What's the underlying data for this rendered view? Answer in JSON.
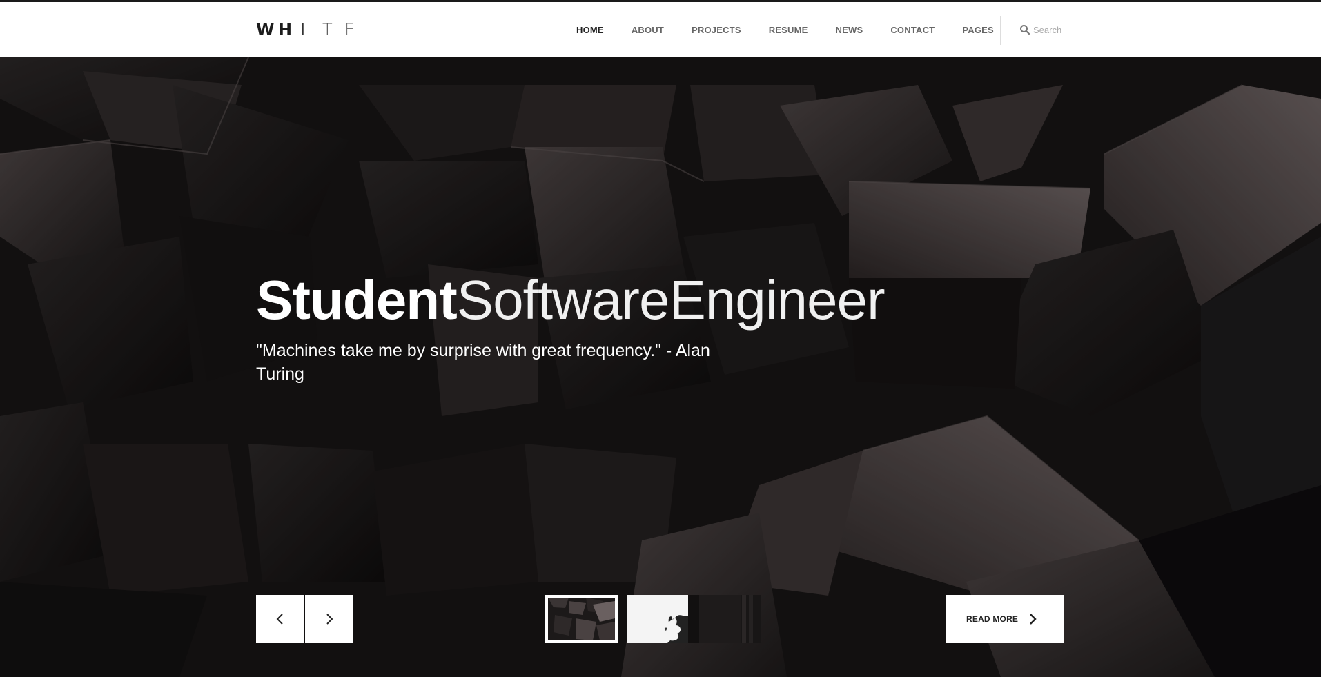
{
  "brand": {
    "logo_letters": [
      "W",
      "H",
      "I",
      "T",
      "E"
    ]
  },
  "nav": {
    "items": [
      {
        "label": "HOME",
        "active": true
      },
      {
        "label": "ABOUT",
        "active": false
      },
      {
        "label": "PROJECTS",
        "active": false
      },
      {
        "label": "RESUME",
        "active": false
      },
      {
        "label": "NEWS",
        "active": false
      },
      {
        "label": "CONTACT",
        "active": false
      },
      {
        "label": "PAGES",
        "active": false
      }
    ]
  },
  "search": {
    "placeholder": "Search",
    "icon": "search-icon"
  },
  "hero": {
    "title_bold": "Student",
    "title_light": "SoftwareEngineer",
    "quote": "\"Machines take me by surprise with great frequency.\" - Alan Turing"
  },
  "slider": {
    "prev_icon": "chevron-left-icon",
    "next_icon": "chevron-right-icon",
    "thumbnails": [
      "dark-geometric-slide",
      "white-splash-slide",
      "dark-panel-slide"
    ],
    "active_index": 0
  },
  "cta": {
    "read_more_label": "READ MORE",
    "icon": "chevron-right-icon"
  },
  "colors": {
    "header_bg": "#ffffff",
    "hero_bg": "#1a1717",
    "text_light": "#ffffff",
    "nav_text": "#666666",
    "nav_active": "#222222"
  }
}
